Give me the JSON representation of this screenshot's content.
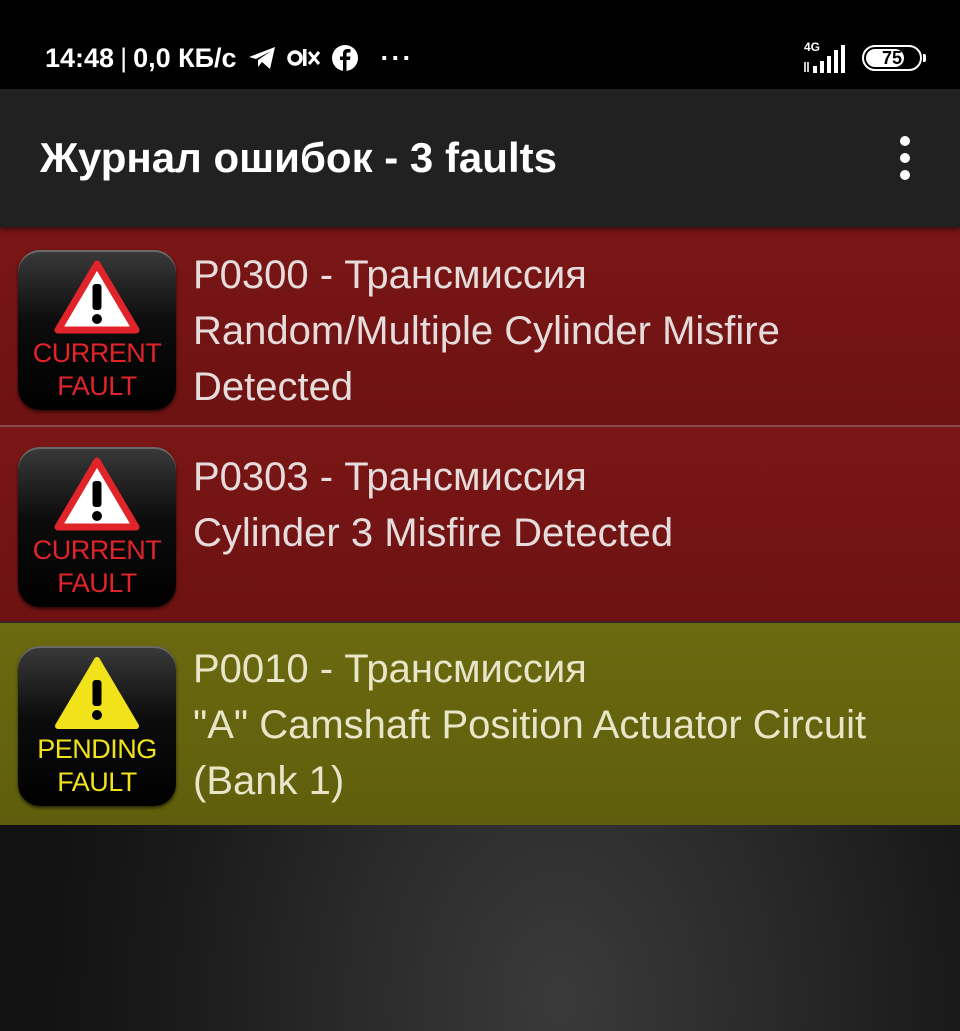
{
  "status_bar": {
    "time": "14:48",
    "separator": "|",
    "speed": "0,0 КБ/с",
    "more": "···",
    "network_type": "4G",
    "battery": "75",
    "battery_level": 0.75,
    "icons": [
      "telegram-icon",
      "olx-icon",
      "facebook-icon",
      "signal-icon",
      "battery-icon"
    ]
  },
  "app_bar": {
    "title": "Журнал ошибок - 3 faults",
    "menu_icon": "overflow-menu-icon"
  },
  "faults": [
    {
      "code": "P0300 - Трансмиссия",
      "description": "Random/Multiple Cylinder Misfire Detected",
      "status_line1": "CURRENT",
      "status_line2": "FAULT",
      "status": "current",
      "color": "#7a1616",
      "icon": "warning-triangle-red-icon"
    },
    {
      "code": "P0303 - Трансмиссия",
      "description": "Cylinder 3 Misfire Detected",
      "status_line1": "CURRENT",
      "status_line2": "FAULT",
      "status": "current",
      "color": "#7a1616",
      "icon": "warning-triangle-red-icon"
    },
    {
      "code": "P0010 - Трансмиссия",
      "description": "\"A\" Camshaft Position Actuator Circuit (Bank 1)",
      "status_line1": "PENDING",
      "status_line2": "FAULT",
      "status": "pending",
      "color": "#6b6a10",
      "icon": "warning-triangle-yellow-icon"
    }
  ]
}
